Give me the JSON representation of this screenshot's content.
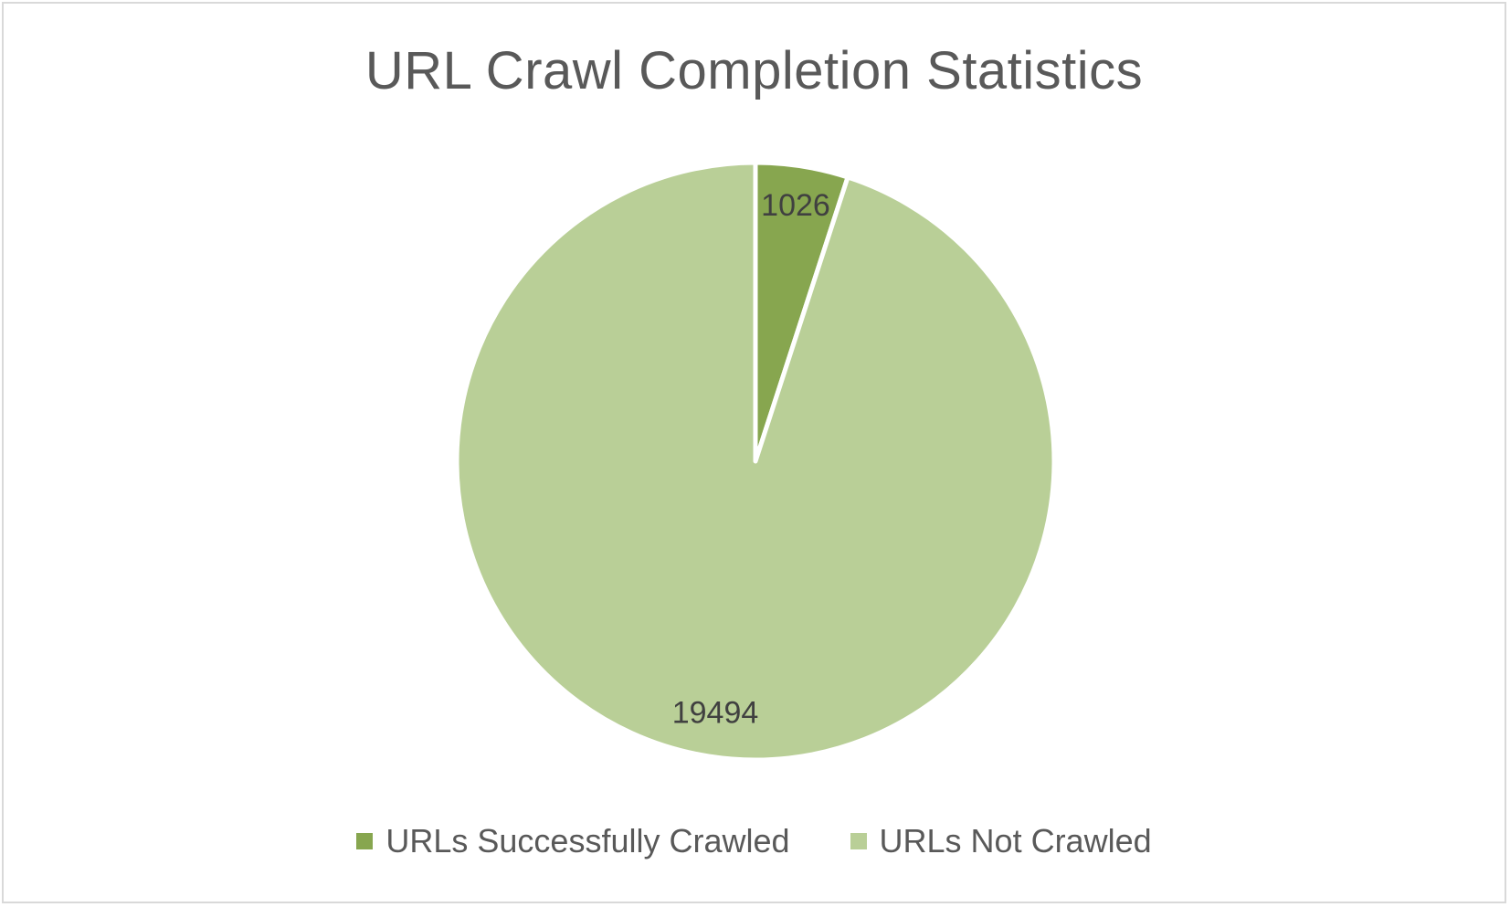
{
  "chart_data": {
    "type": "pie",
    "title": "URL Crawl Completion Statistics",
    "categories": [
      "URLs Successfully Crawled",
      "URLs Not Crawled"
    ],
    "values": [
      1026,
      19494
    ],
    "data_labels": [
      "1026",
      "19494"
    ],
    "colors": [
      "#87a64f",
      "#b9cf97"
    ],
    "legend_position": "bottom"
  }
}
